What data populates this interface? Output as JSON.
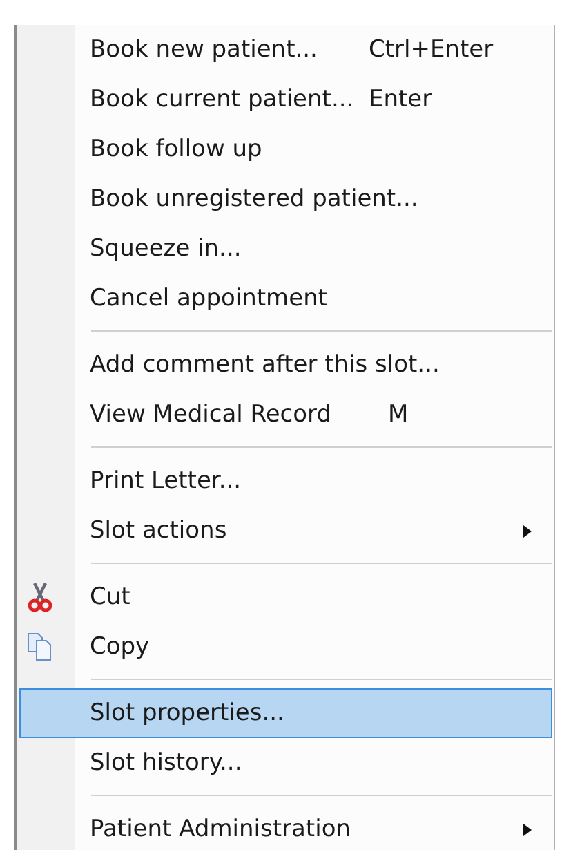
{
  "menu": {
    "items": [
      {
        "kind": "item",
        "label": "Book new patient...",
        "shortcut": "Ctrl+Enter",
        "selected": false
      },
      {
        "kind": "item",
        "label": "Book current patient...",
        "shortcut": "Enter",
        "selected": false
      },
      {
        "kind": "item",
        "label": "Book follow up",
        "selected": false
      },
      {
        "kind": "item",
        "label": "Book unregistered patient...",
        "selected": false
      },
      {
        "kind": "item",
        "label": "Squeeze in...",
        "selected": false
      },
      {
        "kind": "item",
        "label": "Cancel appointment",
        "selected": false
      },
      {
        "kind": "separator"
      },
      {
        "kind": "item",
        "label": "Add comment after this slot...",
        "selected": false
      },
      {
        "kind": "item",
        "label": "View Medical Record",
        "shortcut": "M",
        "selected": false
      },
      {
        "kind": "separator"
      },
      {
        "kind": "item",
        "label": "Print Letter...",
        "selected": false
      },
      {
        "kind": "item",
        "label": "Slot actions",
        "submenu": true,
        "selected": false
      },
      {
        "kind": "separator"
      },
      {
        "kind": "scissors",
        "label": "Cut",
        "selected": false
      },
      {
        "kind": "copy",
        "label": "Copy",
        "selected": false
      },
      {
        "kind": "separator"
      },
      {
        "kind": "item",
        "label": "Slot properties...",
        "selected": true
      },
      {
        "kind": "item",
        "label": "Slot history...",
        "selected": false
      },
      {
        "kind": "separator"
      },
      {
        "kind": "item",
        "label": "Patient Administration",
        "submenu": true,
        "selected": false
      }
    ]
  }
}
